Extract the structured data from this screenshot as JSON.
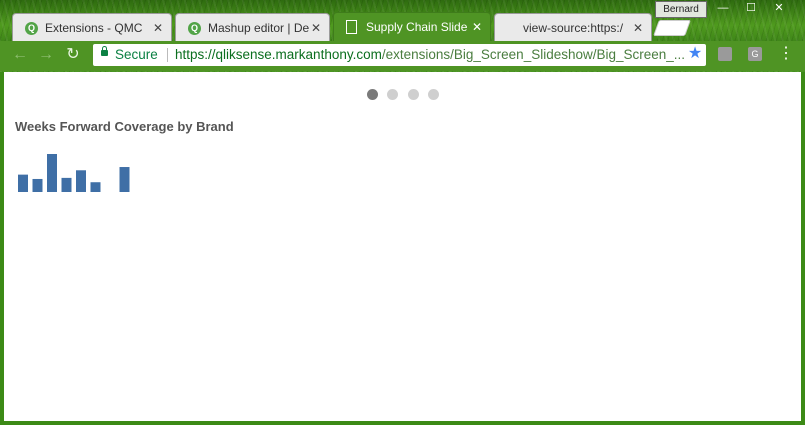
{
  "window": {
    "profile": "Bernard",
    "controls": [
      "—",
      "☐",
      "✕"
    ]
  },
  "tabs": [
    {
      "label": "Extensions - QMC",
      "icon": "q-icon",
      "active": false
    },
    {
      "label": "Mashup editor | De",
      "icon": "q-icon",
      "active": false
    },
    {
      "label": "Supply Chain Slide",
      "icon": "page-icon",
      "active": true
    },
    {
      "label": "view-source:https:/",
      "icon": "",
      "active": false
    }
  ],
  "address_bar": {
    "secure_label": "Secure",
    "url_host": "https://qliksense.markanthony.com",
    "url_path": "/extensions/Big_Screen_Slideshow/Big_Screen_..."
  },
  "extensions": [
    {
      "label": "",
      "icon": "extension-icon"
    },
    {
      "label": "G",
      "icon": "g-extension-icon"
    }
  ],
  "slideshow": {
    "dot_count": 4,
    "active_index": 0
  },
  "chart_title": "Weeks Forward Coverage by Brand",
  "chart_data": {
    "type": "bar",
    "title": "Weeks Forward Coverage by Brand",
    "categories": [
      "",
      "",
      "",
      "",
      "",
      "",
      "",
      ""
    ],
    "values": [
      3.2,
      2.4,
      7.0,
      2.6,
      4.0,
      1.8,
      0,
      4.6
    ],
    "ylim": [
      0,
      7.0
    ],
    "color": "#3f6fa6",
    "grid": false
  }
}
